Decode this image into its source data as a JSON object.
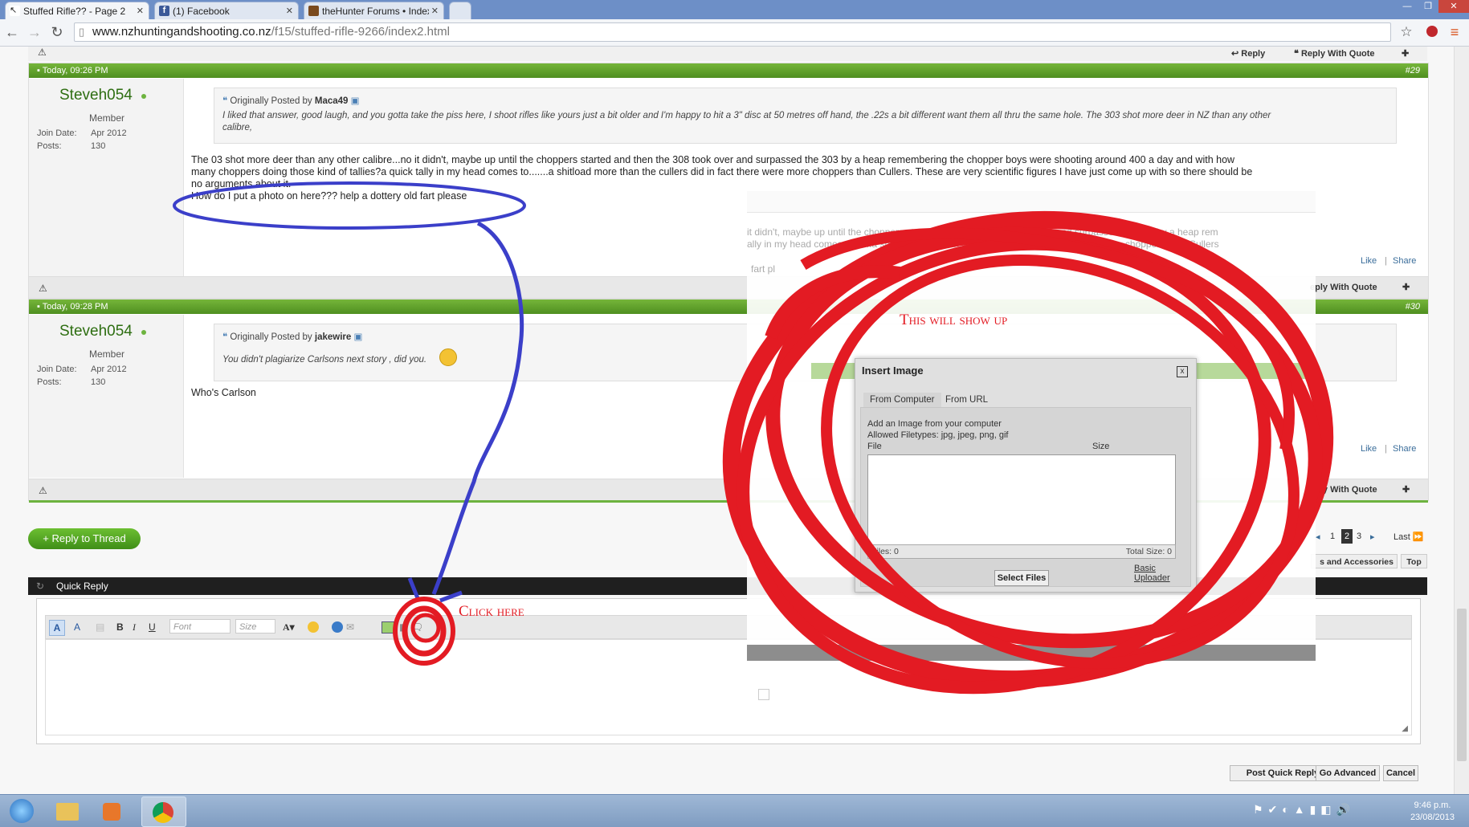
{
  "browser": {
    "tabs": [
      {
        "label": "Stuffed Rifle?? - Page 2",
        "active": true
      },
      {
        "label": "(1) Facebook",
        "active": false
      },
      {
        "label": "theHunter Forums • Index",
        "active": false
      }
    ],
    "url_host": "www.nzhuntingandshooting.co.nz",
    "url_path": "/f15/stuffed-rifle-9266/index2.html"
  },
  "post_actions": {
    "reply": "Reply",
    "reply_with_quote": "Reply With Quote",
    "reply_with_quote_partial": "eply With Quote",
    "like": "Like",
    "share": "Share"
  },
  "posts": [
    {
      "date": "Today, 09:26 PM",
      "number": "#29",
      "user": {
        "name": "Steveh054",
        "title": "Member",
        "join_label": "Join Date:",
        "join_date": "Apr 2012",
        "posts_label": "Posts:",
        "posts": "130"
      },
      "quote_prefix": "Originally Posted by",
      "quote_author": "Maca49",
      "quote_line1": "I liked that answer, good laugh, and you gotta take the piss here, I shoot rifles like yours just a bit older and I'm happy to hit a 3\" disc at 50 metres off hand, the .22s a bit different want them all thru the same hole. The 303 shot more deer in NZ than any other",
      "quote_line2": "calibre,",
      "message_line1": "The 03 shot more deer than any other calibre...no it didn't, maybe up until the choppers started and then the 308 took over and surpassed the 303 by a heap remembering the chopper boys were shooting around 400 a day and with how",
      "message_line2": "many choppers doing those kind of tallies?a quick tally in my head comes to.......a shitload more than the cullers did in fact there were more choppers than Cullers. These are very scientific figures I have just come up with so there should be",
      "message_line3": "no arguments about it.",
      "message_line4": "How do I put a photo on here??? help a dottery old fart please"
    },
    {
      "date": "Today, 09:28 PM",
      "number": "#30",
      "user": {
        "name": "Steveh054",
        "title": "Member",
        "join_label": "Join Date:",
        "join_date": "Apr 2012",
        "posts_label": "Posts:",
        "posts": "130"
      },
      "quote_prefix": "Originally Posted by",
      "quote_author": "jakewire",
      "quote_line1": "You didn't plagiarize Carlsons next story , did you.",
      "message_line1": "Who's Carlson"
    }
  ],
  "ghost_text": {
    "line1": "it didn't, maybe up until the choppers started and then the 308 took over and surpassed the 303 by a heap rem",
    "line2": "ally in my head comes to.......a shitload more than the cullers did in fact there were more choppers than Cullers",
    "line3": "fart pl"
  },
  "reply_button": "+ Reply to Thread",
  "pagination": {
    "pages": [
      "1",
      "2",
      "3"
    ],
    "current": "2",
    "last": "Last"
  },
  "crumbs": {
    "accessories": "s and Accessories",
    "top": "Top"
  },
  "quick_reply": {
    "title": "Quick Reply",
    "font_placeholder": "Font",
    "size_placeholder": "Size",
    "bold": "B",
    "italic": "I",
    "underline": "U"
  },
  "bottom_buttons": {
    "post": "Post Quick Reply",
    "advanced": "Go Advanced",
    "cancel": "Cancel"
  },
  "insert_image": {
    "title": "Insert Image",
    "close": "x",
    "tab_computer": "From Computer",
    "tab_url": "From URL",
    "intro": "Add an Image from your computer",
    "allowed": "Allowed Filetypes: jpg, jpeg, png, gif",
    "col_file": "File",
    "col_size": "Size",
    "files": "Files: 0",
    "total_size": "Total Size: 0",
    "select_files": "Select Files",
    "basic_line1": "Basic",
    "basic_line2": "Uploader"
  },
  "annotations": {
    "show": "This will show up",
    "click": "Click here"
  },
  "taskbar": {
    "time": "9:46 p.m.",
    "date": "23/08/2013"
  },
  "colors": {
    "green_header": "#5aa02c",
    "annotation_red": "#e31b23",
    "annotation_blue": "#3b3fc9"
  }
}
